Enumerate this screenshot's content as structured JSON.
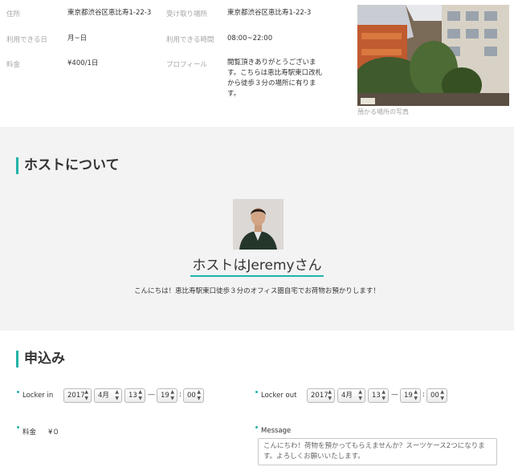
{
  "listing": {
    "address_label": "住所",
    "address_value": "東京都渋谷区恵比寿1-22-3",
    "pickup_label": "受け取り場所",
    "pickup_value": "東京都渋谷区恵比寿1-22-3",
    "days_label": "利用できる日",
    "days_value": "月~日",
    "hours_label": "利用できる時間",
    "hours_value": "08:00~22:00",
    "price_label": "料金",
    "price_value": "¥400/1日",
    "profile_label": "プロフィール",
    "profile_value": "閲覧頂きありがとうございます。こちらは恵比寿駅東口改札から徒歩３分の場所に有ります。",
    "photo_caption": "預かる場所の写真"
  },
  "host": {
    "section_title": "ホストについて",
    "name": "ホストはJeremyさん",
    "description": "こんにちは！恵比寿駅東口徒歩３分のオフィス圏自宅でお荷物お預かりします！"
  },
  "apply": {
    "section_title": "申込み",
    "locker_in_label": "Locker in",
    "locker_out_label": "Locker out",
    "locker_in": {
      "year": "2017",
      "month": "4月",
      "day": "13",
      "hour": "19",
      "minute": "00"
    },
    "locker_out": {
      "year": "2017",
      "month": "4月",
      "day": "13",
      "hour": "19",
      "minute": "00"
    },
    "dash": "—",
    "colon": ":",
    "fee_label": "料金",
    "fee_value": "¥０",
    "message_label": "Message",
    "message_value": "こんにちわ！荷物を預かってもらえませんか？スーツケース2つになります。よろしくお願いいたします。"
  },
  "colors": {
    "accent": "#21b3a8",
    "host_bg": "#f3f3f3"
  },
  "icons": {
    "select_arrow": "updown-arrow-icon",
    "bullet": "teal-dot-icon"
  }
}
